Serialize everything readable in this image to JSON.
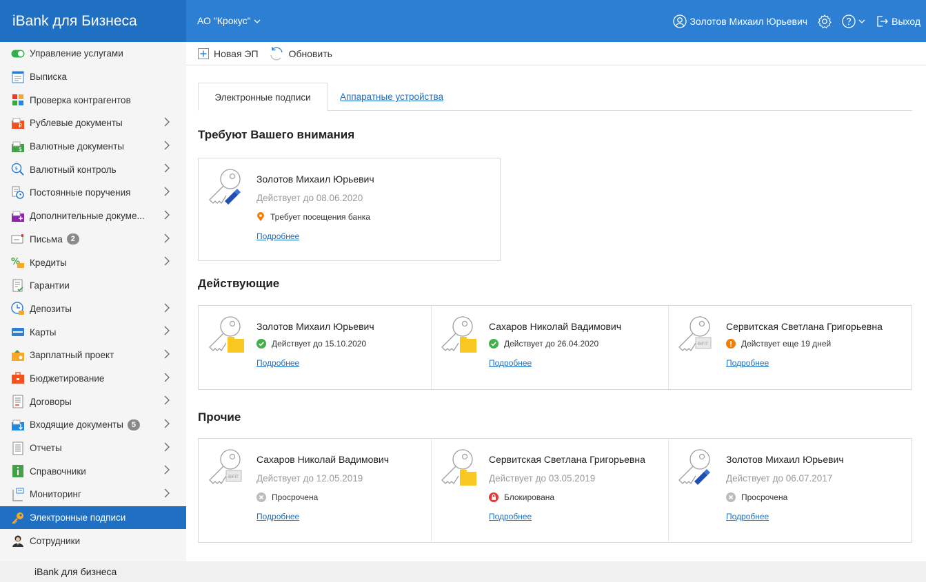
{
  "header": {
    "brand": "iBank для Бизнеса",
    "org": "АО \"Крокус\"",
    "user": "Золотов Михаил Юрьевич",
    "logout": "Выход",
    "colors": {
      "bar": "#2d7fd3",
      "brand_bg": "#1f6fc2"
    }
  },
  "sidebar": {
    "items": [
      {
        "label": "Управление услугами",
        "icon": "toggle-icon",
        "chevron": false
      },
      {
        "label": "Выписка",
        "icon": "statement-icon",
        "chevron": false
      },
      {
        "label": "Проверка контрагентов",
        "icon": "check-partners-icon",
        "chevron": false
      },
      {
        "label": "Рублевые документы",
        "icon": "ruble-docs-icon",
        "chevron": true
      },
      {
        "label": "Валютные документы",
        "icon": "currency-docs-icon",
        "chevron": true
      },
      {
        "label": "Валютный контроль",
        "icon": "currency-control-icon",
        "chevron": true
      },
      {
        "label": "Постоянные поручения",
        "icon": "standing-orders-icon",
        "chevron": true
      },
      {
        "label": "Дополнительные докуме...",
        "icon": "additional-docs-icon",
        "chevron": true
      },
      {
        "label": "Письма",
        "icon": "letters-icon",
        "chevron": true,
        "badge": "2"
      },
      {
        "label": "Кредиты",
        "icon": "credits-icon",
        "chevron": true
      },
      {
        "label": "Гарантии",
        "icon": "guarantees-icon",
        "chevron": false
      },
      {
        "label": "Депозиты",
        "icon": "deposits-icon",
        "chevron": true
      },
      {
        "label": "Карты",
        "icon": "cards-icon",
        "chevron": true
      },
      {
        "label": "Зарплатный проект",
        "icon": "salary-project-icon",
        "chevron": true
      },
      {
        "label": "Бюджетирование",
        "icon": "budgeting-icon",
        "chevron": true
      },
      {
        "label": "Договоры",
        "icon": "contracts-icon",
        "chevron": true
      },
      {
        "label": "Входящие документы",
        "icon": "incoming-docs-icon",
        "chevron": true,
        "badge": "5"
      },
      {
        "label": "Отчеты",
        "icon": "reports-icon",
        "chevron": true
      },
      {
        "label": "Справочники",
        "icon": "directories-icon",
        "chevron": true
      },
      {
        "label": "Мониторинг",
        "icon": "monitoring-icon",
        "chevron": true
      },
      {
        "label": "Электронные подписи",
        "icon": "key-icon",
        "chevron": false,
        "active": true
      },
      {
        "label": "Сотрудники",
        "icon": "employees-icon",
        "chevron": false
      }
    ]
  },
  "footer": {
    "text": "iBank для бизнеса"
  },
  "toolbar": {
    "new_ep": "Новая ЭП",
    "refresh": "Обновить"
  },
  "tabs": {
    "active": "Электронные подписи",
    "other": "Аппаратные устройства"
  },
  "sections": {
    "attention": {
      "title": "Требуют Вашего внимания",
      "cards": [
        {
          "name": "Золотов Михаил Юрьевич",
          "valid": "Действует до 08.06.2020",
          "status": "Требует посещения банка",
          "status_icon": "location-pin-icon",
          "key_type": "token",
          "link": "Подробнее"
        }
      ]
    },
    "active": {
      "title": "Действующие",
      "cards": [
        {
          "name": "Золотов Михаил Юрьевич",
          "status": "Действует до 15.10.2020",
          "status_icon": "check-circle-icon",
          "key_type": "folder",
          "link": "Подробнее"
        },
        {
          "name": "Сахаров Николай Вадимович",
          "status": "Действует до 26.04.2020",
          "status_icon": "check-circle-icon",
          "key_type": "folder",
          "link": "Подробнее"
        },
        {
          "name": "Сервитская Светлана Григорьевна",
          "status": "Действует еще 19 дней",
          "status_icon": "warning-circle-icon",
          "key_type": "bifit",
          "link": "Подробнее"
        }
      ]
    },
    "other": {
      "title": "Прочие",
      "cards": [
        {
          "name": "Сахаров Николай Вадимович",
          "valid": "Действует до 12.05.2019",
          "status": "Просрочена",
          "status_icon": "expired-circle-icon",
          "key_type": "bifit",
          "link": "Подробнее"
        },
        {
          "name": "Сервитская Светлана Григорьевна",
          "valid": "Действует до 03.05.2019",
          "status": "Блокирована",
          "status_icon": "lock-circle-icon",
          "key_type": "folder",
          "link": "Подробнее"
        },
        {
          "name": "Золотов Михаил Юрьевич",
          "valid": "Действует до 06.07.2017",
          "status": "Просрочена",
          "status_icon": "expired-circle-icon",
          "key_type": "token",
          "link": "Подробнее"
        }
      ]
    }
  }
}
